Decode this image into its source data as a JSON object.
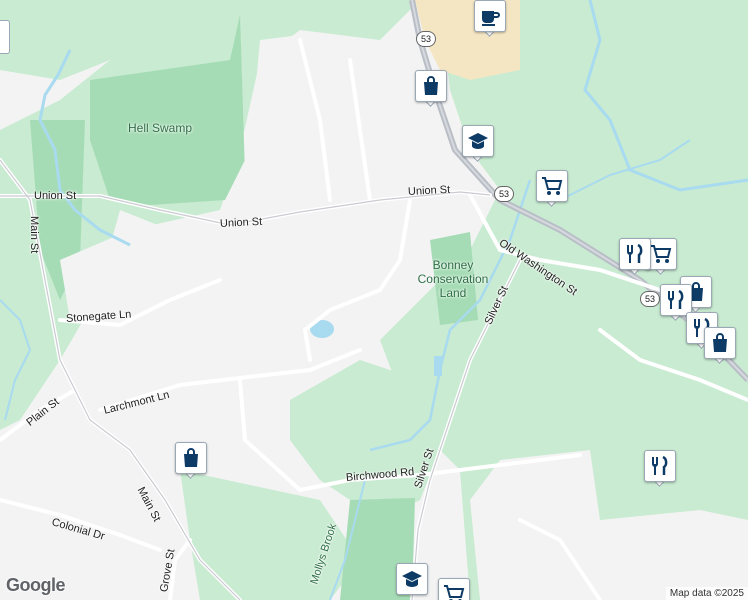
{
  "map": {
    "colors": {
      "land": "#f3f3f4",
      "park": "#c8ebd1",
      "forest": "#a6dcb5",
      "water": "#a8daf0",
      "road": "#ffffff",
      "highway": "#b9bec6",
      "commercial": "#f4e6c3"
    },
    "roads": {
      "union_st_1": "Union St",
      "union_st_2": "Union St",
      "main_st_1": "Main St",
      "main_st_2": "Main St",
      "stonegate_ln": "Stonegate Ln",
      "plain_st": "Plain St",
      "larchmont_ln": "Larchmont Ln",
      "colonial_dr": "Colonial Dr",
      "grove_st": "Grove St",
      "birchwood_rd": "Birchwood Rd",
      "silver_st_1": "Silver St",
      "silver_st_2": "Silver St",
      "old_washington_st": "Old Washington St",
      "mollys_brook": "Mollys Brook"
    },
    "areas": {
      "hell_swamp": "Hell Swamp",
      "bonney_line1": "Bonney",
      "bonney_line2": "Conservation",
      "bonney_line3": "Land"
    },
    "shields": [
      "53",
      "53",
      "53"
    ],
    "pins": [
      {
        "icon": "coffee-icon"
      },
      {
        "icon": "shopping-bag-icon"
      },
      {
        "icon": "school-icon"
      },
      {
        "icon": "shopping-cart-icon"
      },
      {
        "icon": "restaurant-icon"
      },
      {
        "icon": "shopping-cart-icon"
      },
      {
        "icon": "shopping-bag-icon"
      },
      {
        "icon": "restaurant-icon"
      },
      {
        "icon": "restaurant-icon"
      },
      {
        "icon": "shopping-bag-icon"
      },
      {
        "icon": "shopping-bag-icon"
      },
      {
        "icon": "restaurant-icon"
      },
      {
        "icon": "school-icon"
      },
      {
        "icon": "shopping-cart-icon"
      }
    ],
    "logo": "Google",
    "attribution": "Map data ©2025"
  }
}
